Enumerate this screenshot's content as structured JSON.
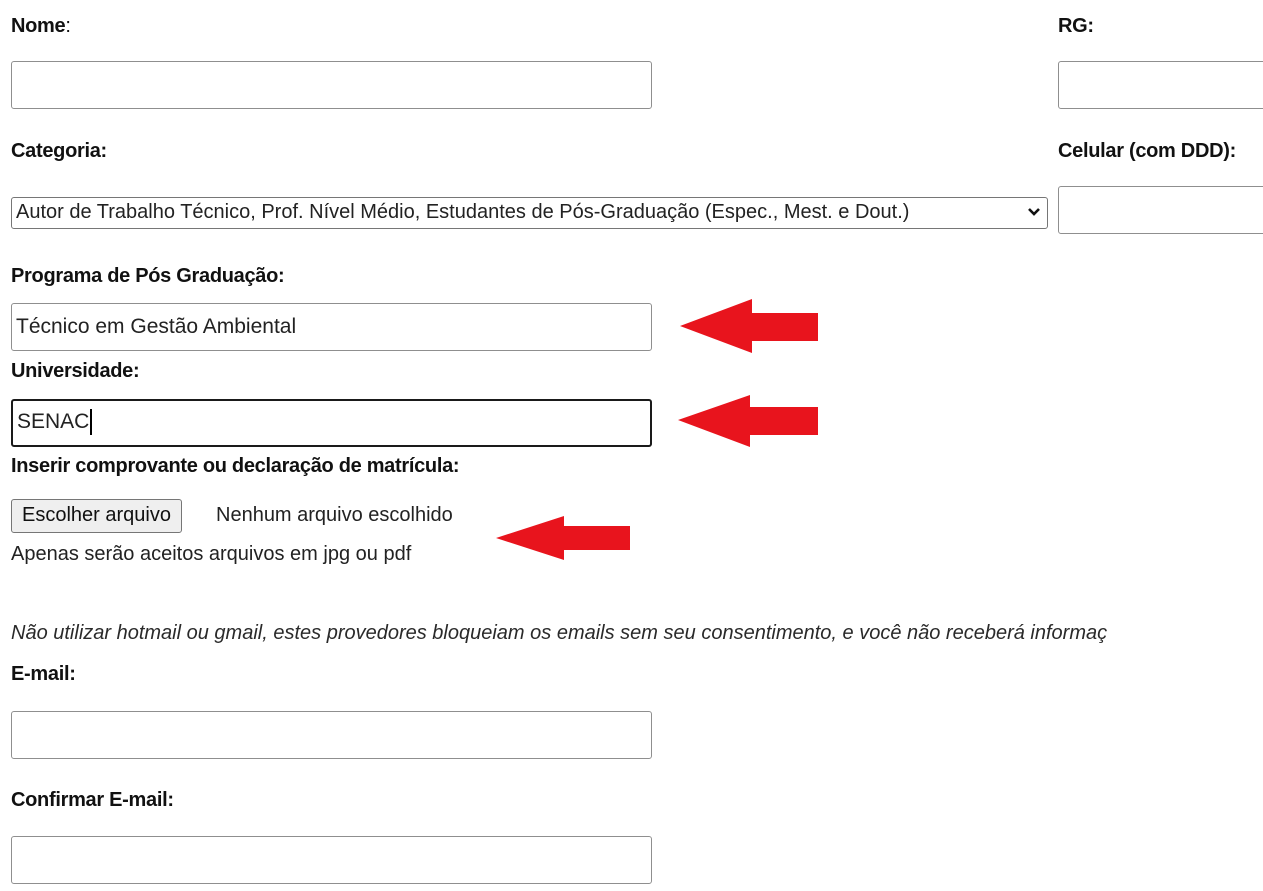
{
  "form": {
    "nome_label": "Nome",
    "nome_value": "",
    "rg_label": "RG:",
    "rg_value": "",
    "categoria_label": "Categoria:",
    "categoria_selected": "Autor de Trabalho Técnico, Prof. Nível Médio, Estudantes de Pós-Graduação (Espec., Mest. e Dout.)",
    "celular_label": "Celular (com DDD):",
    "celular_value": "",
    "programa_label": "Programa de Pós Graduação:",
    "programa_value": "Técnico em Gestão Ambiental",
    "universidade_label": "Universidade:",
    "universidade_value": "SENAC",
    "comprovante_label": "Inserir comprovante ou declaração de matrícula:",
    "file_button": "Escolher arquivo",
    "file_status": "Nenhum arquivo escolhido",
    "file_hint": "Apenas serão aceitos arquivos em jpg ou pdf",
    "email_warning": "Não utilizar hotmail ou gmail, estes provedores bloqueiam os emails sem seu consentimento, e você não receberá informaç",
    "email_label": "E-mail:",
    "email_value": "",
    "confirm_email_label": "Confirmar E-mail:",
    "confirm_email_value": ""
  },
  "annotations": {
    "arrow_color": "#e8141d",
    "arrow_icon": "red-arrow-left-icon"
  }
}
